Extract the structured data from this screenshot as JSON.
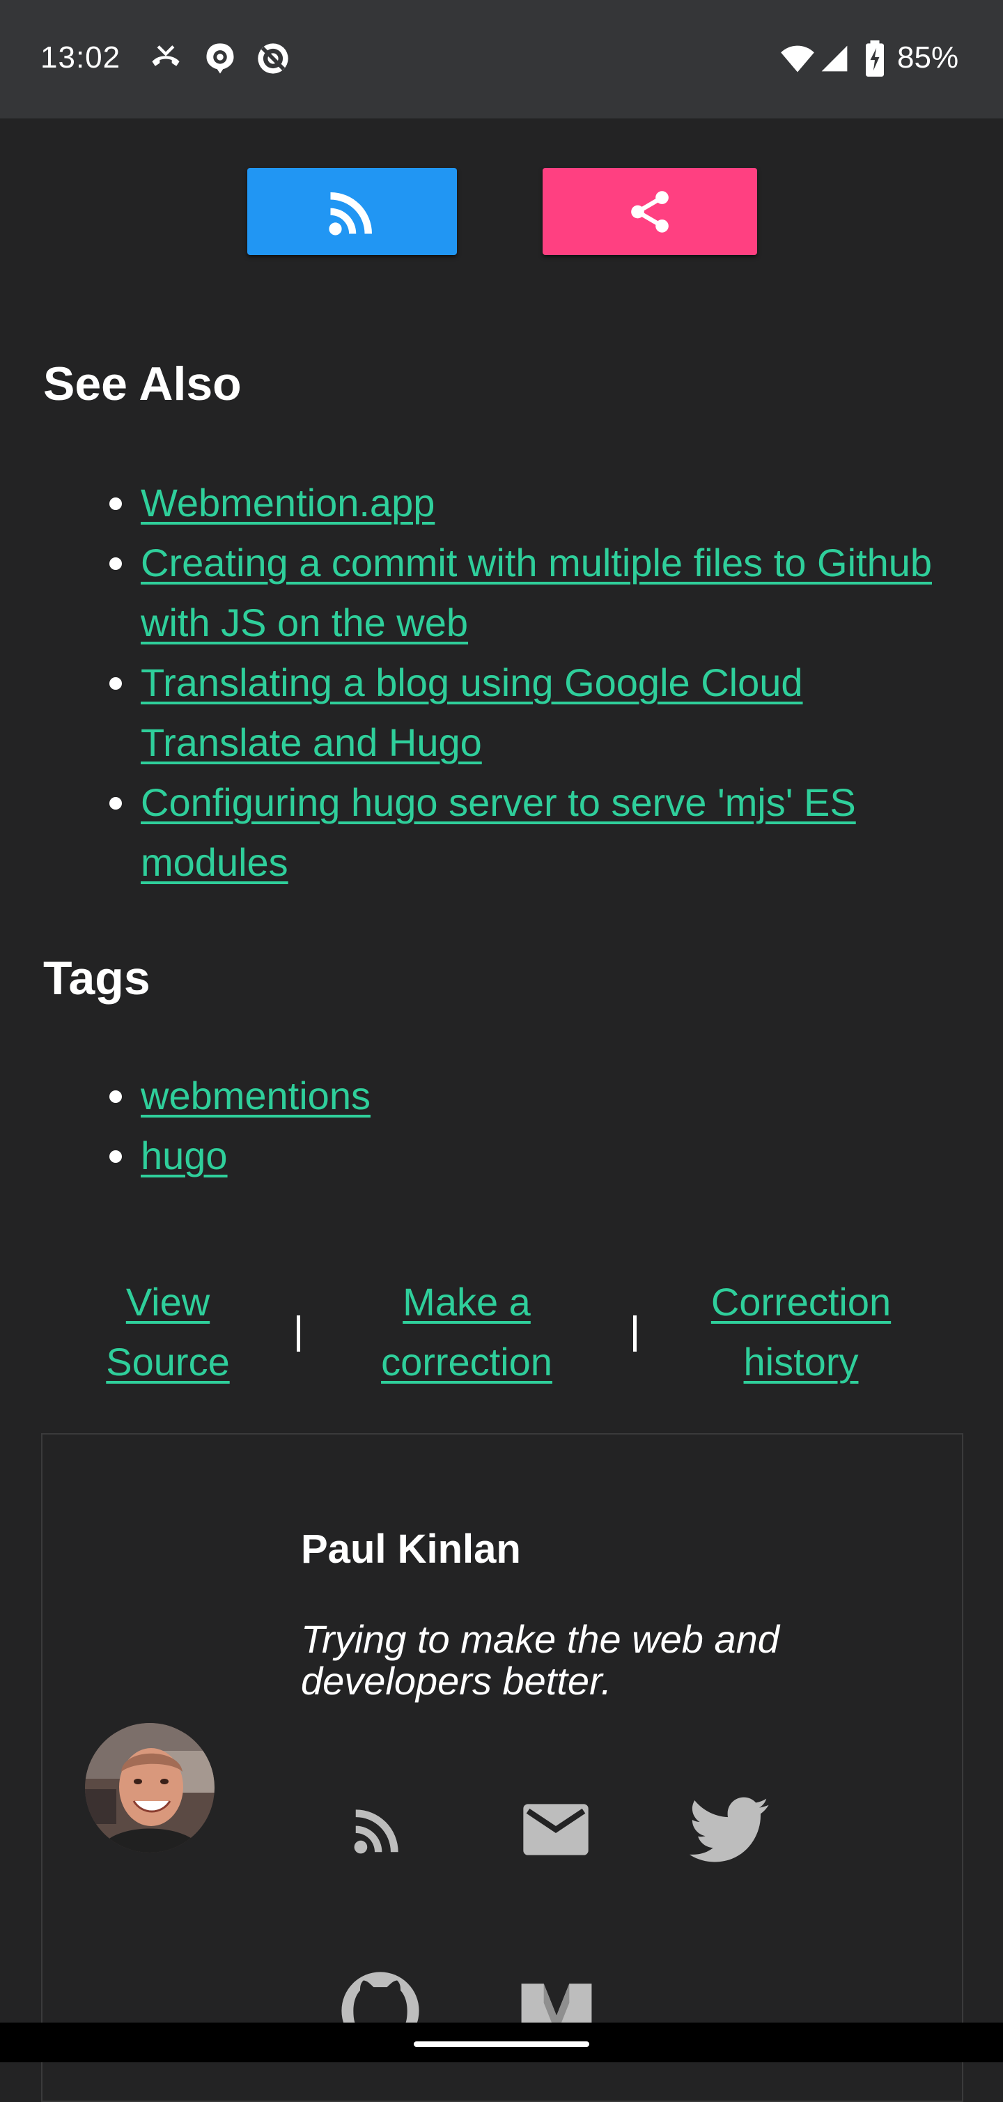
{
  "status_bar": {
    "time": "13:02",
    "battery": "85%",
    "icons": [
      "missed-call-icon",
      "at-sign-notification-icon",
      "no-sign-notification-icon",
      "wifi-icon",
      "signal-icon",
      "battery-charging-icon"
    ]
  },
  "actions": {
    "rss_icon": "rss-icon",
    "share_icon": "share-icon",
    "rss_color": "#2196f3",
    "share_color": "#ff4081"
  },
  "see_also": {
    "heading": "See Also",
    "items": [
      {
        "label": "Webmention.app"
      },
      {
        "label": "Creating a commit with multiple files to Github with JS on the web"
      },
      {
        "label": "Translating a blog using Google Cloud Translate and Hugo"
      },
      {
        "label": "Configuring hugo server to serve 'mjs' ES modules"
      }
    ]
  },
  "tags": {
    "heading": "Tags",
    "items": [
      {
        "label": "webmentions"
      },
      {
        "label": "hugo"
      }
    ]
  },
  "footer_links": {
    "view_source": "View Source",
    "make_correction": "Make a correction",
    "correction_history": "Correction history",
    "separator": "|"
  },
  "author": {
    "name": "Paul Kinlan",
    "tagline": "Trying to make the web and developers better.",
    "social_icons": [
      "rss-icon",
      "email-icon",
      "twitter-icon",
      "github-icon",
      "medium-icon"
    ]
  },
  "colors": {
    "background": "#232324",
    "status_bar": "#353638",
    "link": "#2fcf9b"
  }
}
